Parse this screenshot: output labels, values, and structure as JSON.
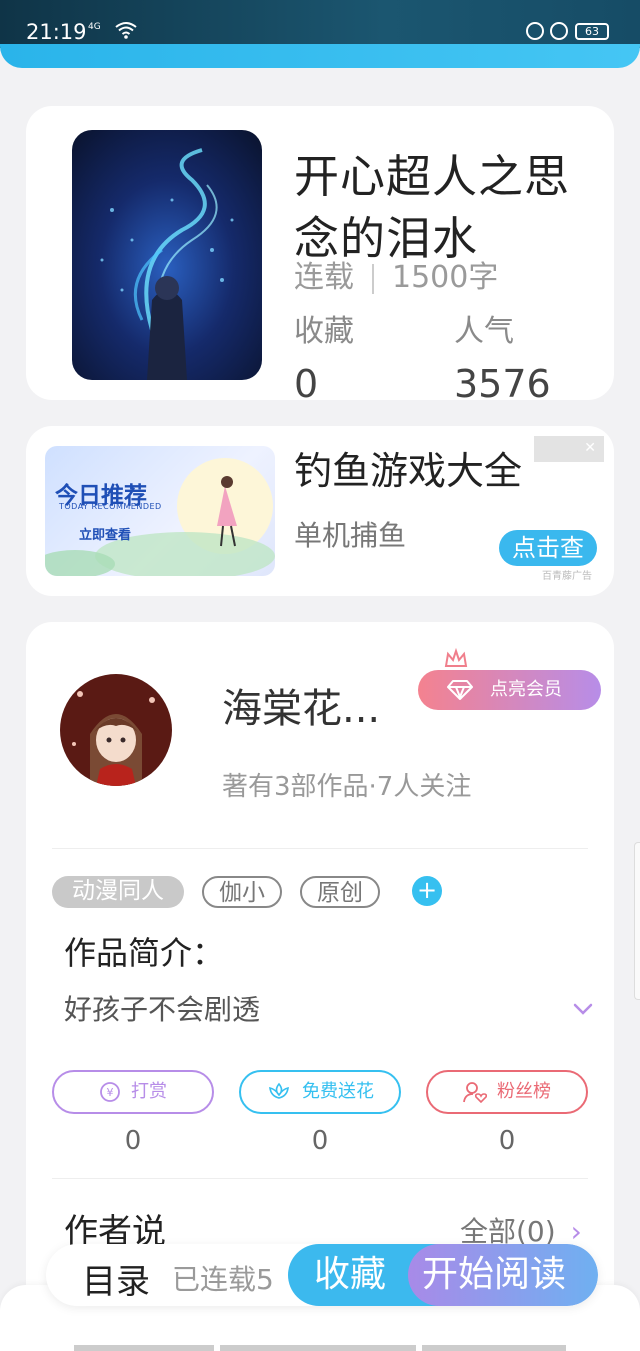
{
  "status_bar": {
    "time": "21:19",
    "signal": "4G",
    "battery": "63"
  },
  "book": {
    "title": "开心超人之思念的泪水",
    "status": "连载",
    "word_count": "1500字",
    "favorites_label": "收藏",
    "favorites_value": "0",
    "popularity_label": "人气",
    "popularity_value": "3576"
  },
  "ad": {
    "banner_line1": "今日推荐",
    "banner_line2": "TODAY RECOMMENDED",
    "banner_line3": "立即查看",
    "title": "钓鱼游戏大全",
    "subtitle": "单机捕鱼",
    "button": "点击查",
    "tag": "百青藤广告"
  },
  "author": {
    "name": "海棠花...",
    "vip_button": "点亮会员",
    "stats": "著有3部作品·7人关注"
  },
  "tags": [
    "动漫同人",
    "伽小",
    "原创"
  ],
  "intro": {
    "heading": "作品简介：",
    "text": "好孩子不会剧透"
  },
  "actions": [
    {
      "label": "打赏",
      "value": "0",
      "color": "#b78de8"
    },
    {
      "label": "免费送花",
      "value": "0",
      "color": "#36c0f0"
    },
    {
      "label": "粉丝榜",
      "value": "0",
      "color": "#ea6a75"
    }
  ],
  "author_says": {
    "heading": "作者说",
    "all_link": "全部(0)"
  },
  "bottom_bar": {
    "toc": "目录",
    "serial": "已连载5",
    "favorite_button": "收藏",
    "read_button": "开始阅读"
  }
}
